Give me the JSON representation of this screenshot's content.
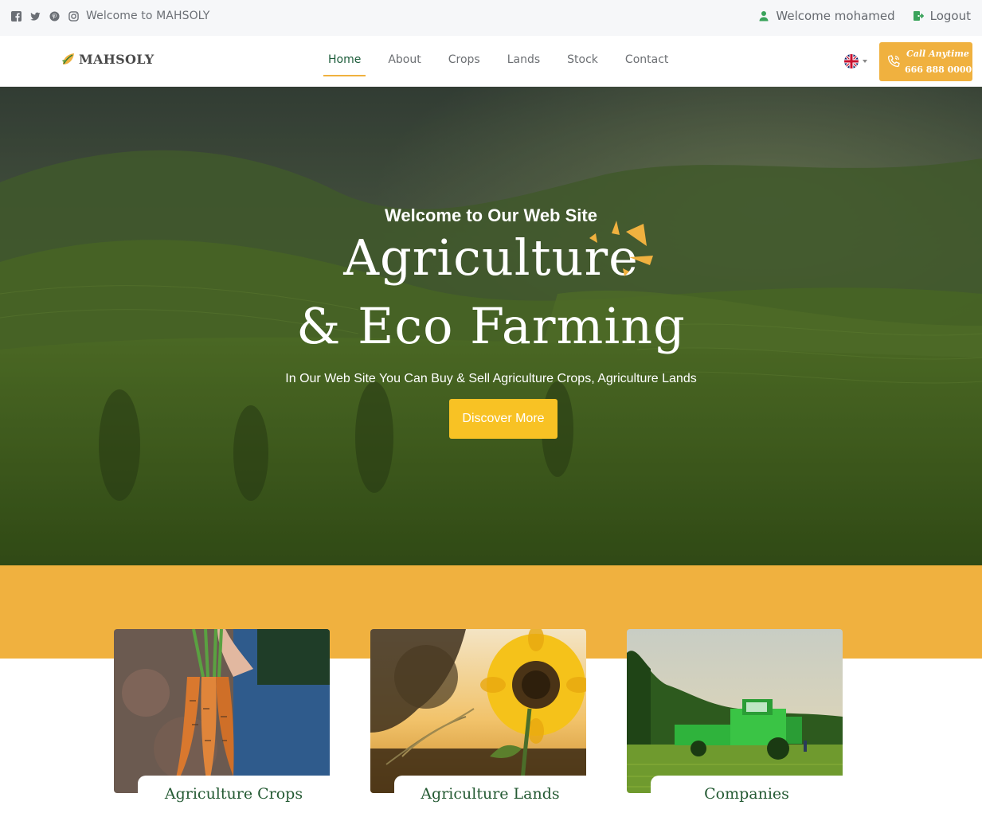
{
  "topbar": {
    "social_icons": [
      "facebook-icon",
      "twitter-icon",
      "pinterest-icon",
      "instagram-icon"
    ],
    "welcome_site": "Welcome to MAHSOLY",
    "welcome_user": "Welcome mohamed",
    "logout": "Logout"
  },
  "header": {
    "logo_text": "MAHSOLY",
    "nav": [
      "Home",
      "About",
      "Crops",
      "Lands",
      "Stock",
      "Contact"
    ],
    "active_nav": "Home",
    "language_flag": "uk-flag-icon",
    "call_label": "Call Anytime",
    "call_number": "666 888 0000"
  },
  "hero": {
    "subtitle": "Welcome to Our Web Site",
    "title_line1": "Agriculture",
    "title_line2": "& Eco Farming",
    "description": "In Our Web Site You Can Buy & Sell Agriculture Crops, Agriculture Lands",
    "button": "Discover More"
  },
  "features": [
    {
      "label": "Agriculture Crops",
      "image": "carrots-image"
    },
    {
      "label": "Agriculture Lands",
      "image": "sunflower-image"
    },
    {
      "label": "Companies",
      "image": "harvester-image"
    }
  ],
  "colors": {
    "accent": "#f0b13f",
    "button": "#f8c224",
    "brand_green": "#245a33",
    "topbar_bg": "#f6f7f9"
  }
}
